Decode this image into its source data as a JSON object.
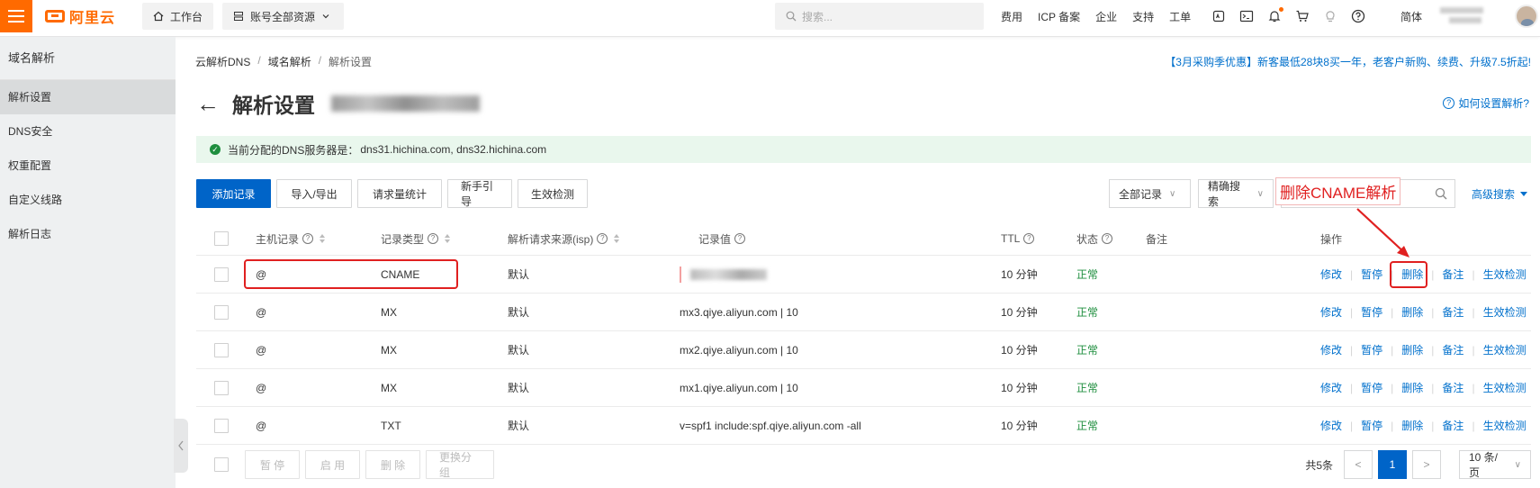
{
  "topbar": {
    "brand": "阿里云",
    "workbench": "工作台",
    "resources": "账号全部资源",
    "search_placeholder": "搜索...",
    "links": [
      "费用",
      "ICP 备案",
      "企业",
      "支持",
      "工单"
    ],
    "language": "简体"
  },
  "sidebar": {
    "title": "域名解析",
    "items": [
      {
        "label": "解析设置",
        "active": true
      },
      {
        "label": "DNS安全",
        "active": false
      },
      {
        "label": "权重配置",
        "active": false
      },
      {
        "label": "自定义线路",
        "active": false
      },
      {
        "label": "解析日志",
        "active": false
      }
    ]
  },
  "breadcrumb": [
    "云解析DNS",
    "域名解析",
    "解析设置"
  ],
  "promo": "【3月采购季优惠】新客最低28块8买一年，老客户新购、续费、升级7.5折起!",
  "page": {
    "title": "解析设置",
    "help": "如何设置解析?",
    "dns_label": "当前分配的DNS服务器是：",
    "dns_servers": "dns31.hichina.com, dns32.hichina.com"
  },
  "toolbar": {
    "add": "添加记录",
    "import_export": "导入/导出",
    "stats": "请求量统计",
    "guide": "新手引导",
    "check": "生效检测",
    "filter": "全部记录",
    "search_mode": "精确搜索",
    "advanced": "高级搜索"
  },
  "annotation": "删除CNAME解析",
  "table": {
    "headers": {
      "host": "主机记录",
      "type": "记录类型",
      "isp": "解析请求来源(isp)",
      "value": "记录值",
      "ttl": "TTL",
      "status": "状态",
      "remark": "备注",
      "ops": "操作"
    },
    "actions": [
      "修改",
      "暂停",
      "删除",
      "备注",
      "生效检测"
    ],
    "rows": [
      {
        "host": "@",
        "type": "CNAME",
        "isp": "默认",
        "value": "",
        "ttl": "10 分钟",
        "status": "正常"
      },
      {
        "host": "@",
        "type": "MX",
        "isp": "默认",
        "value": "mx3.qiye.aliyun.com | 10",
        "ttl": "10 分钟",
        "status": "正常"
      },
      {
        "host": "@",
        "type": "MX",
        "isp": "默认",
        "value": "mx2.qiye.aliyun.com | 10",
        "ttl": "10 分钟",
        "status": "正常"
      },
      {
        "host": "@",
        "type": "MX",
        "isp": "默认",
        "value": "mx1.qiye.aliyun.com | 10",
        "ttl": "10 分钟",
        "status": "正常"
      },
      {
        "host": "@",
        "type": "TXT",
        "isp": "默认",
        "value": "v=spf1 include:spf.qiye.aliyun.com -all",
        "ttl": "10 分钟",
        "status": "正常"
      }
    ]
  },
  "footer": {
    "batch": [
      "暂 停",
      "启 用",
      "删 除",
      "更换分组"
    ],
    "total": "共5条",
    "page": "1",
    "page_size": "10 条/页"
  },
  "colors": {
    "brand": "#ff6a00",
    "primary": "#0064c8",
    "link": "#0070cc",
    "success": "#1e8e3e",
    "annotation": "#e02020"
  }
}
